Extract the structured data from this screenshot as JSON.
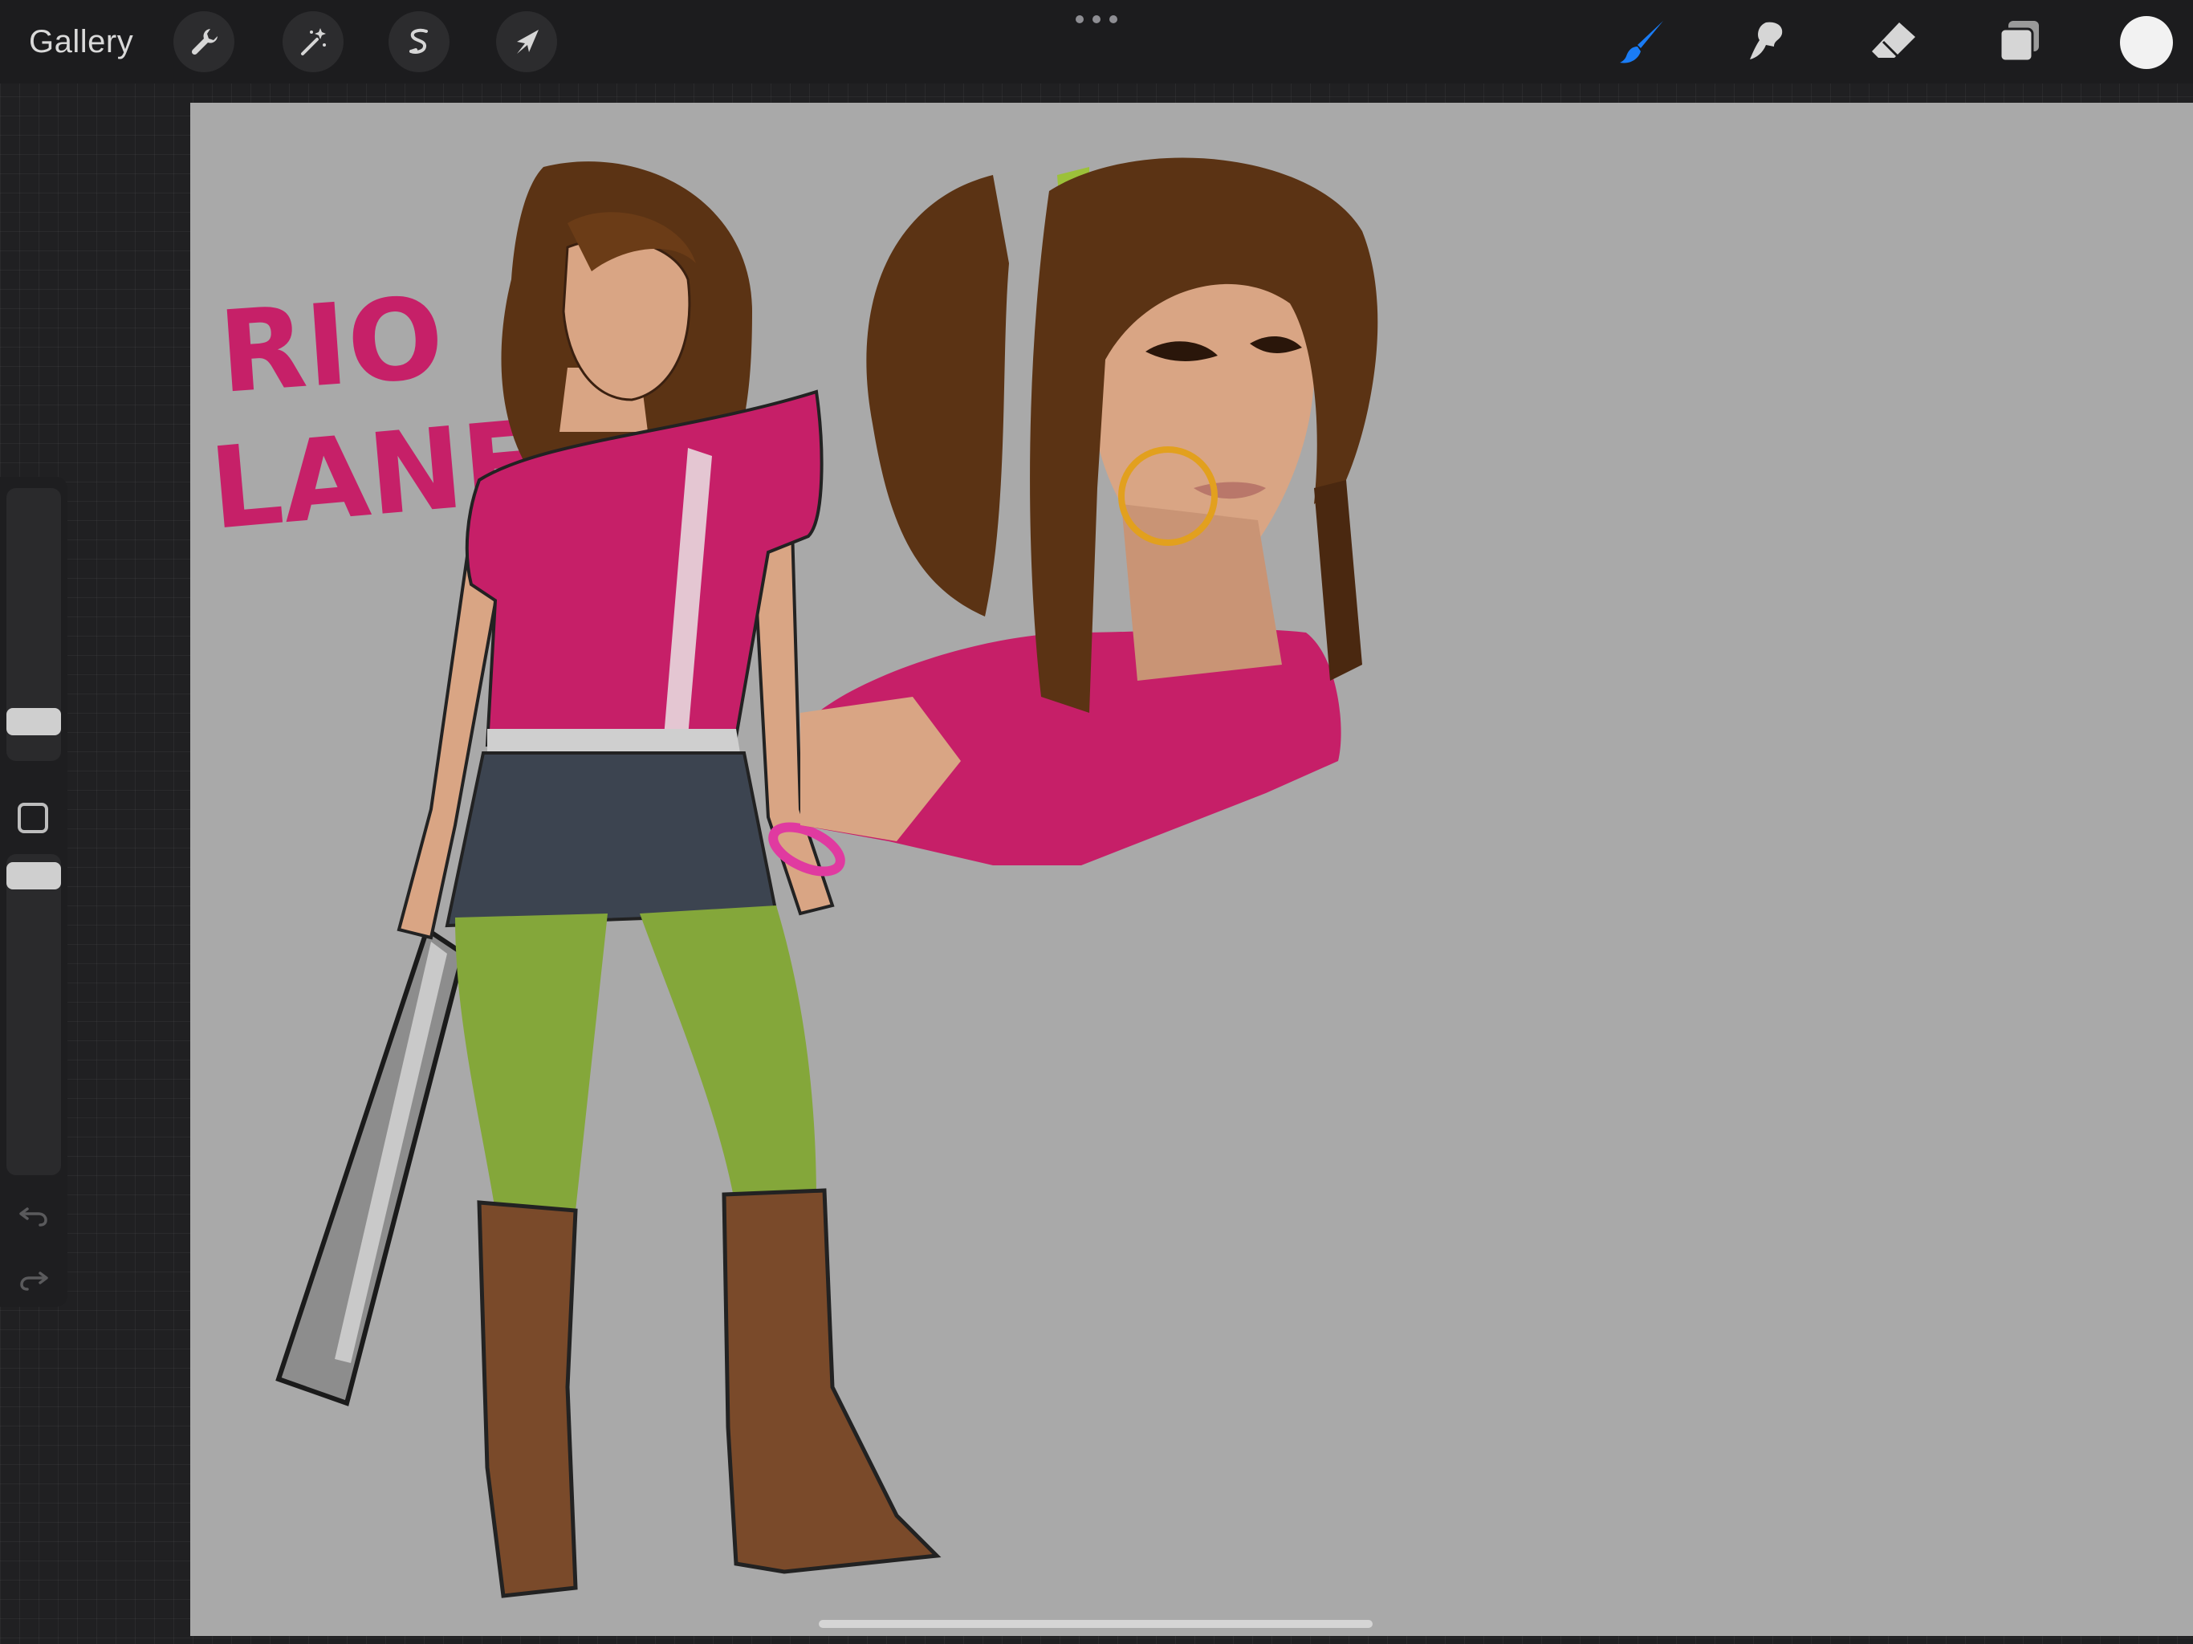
{
  "toolbar": {
    "gallery_label": "Gallery",
    "left_tools": [
      {
        "name": "actions",
        "icon": "wrench-icon"
      },
      {
        "name": "adjustments",
        "icon": "magic-wand-icon"
      },
      {
        "name": "selection",
        "icon": "selection-s-icon"
      },
      {
        "name": "transform",
        "icon": "arrow-cursor-icon"
      }
    ],
    "more_icon": "more-dots-icon",
    "right_tools": [
      {
        "name": "brush",
        "icon": "brush-icon",
        "active": true
      },
      {
        "name": "smudge",
        "icon": "smudge-icon",
        "active": false
      },
      {
        "name": "eraser",
        "icon": "eraser-icon",
        "active": false
      },
      {
        "name": "layers",
        "icon": "layers-icon",
        "active": false
      }
    ],
    "current_color": "#f2f2f2",
    "active_tool_color": "#1a7cf5"
  },
  "sidebar": {
    "brush_size_icon": "slider-handle",
    "modify_icon": "square-modify-icon",
    "brush_opacity_icon": "slider-handle",
    "undo_icon": "undo-icon",
    "redo_icon": "redo-icon"
  },
  "canvas": {
    "background": "#a9a9a9",
    "lettering_line1": "RIO",
    "lettering_line2": "LANE",
    "lettering_color": "#c62068",
    "palette": {
      "hair": "#5b3314",
      "shirt": "#c61f68",
      "skirt": "#3c4450",
      "tights": "#84a73a",
      "boots": "#7a4a2a",
      "skin": "#d9a584",
      "bat": "#8d8d8d",
      "earring": "#e2a01e",
      "scrunchie": "#9cc13a"
    }
  }
}
